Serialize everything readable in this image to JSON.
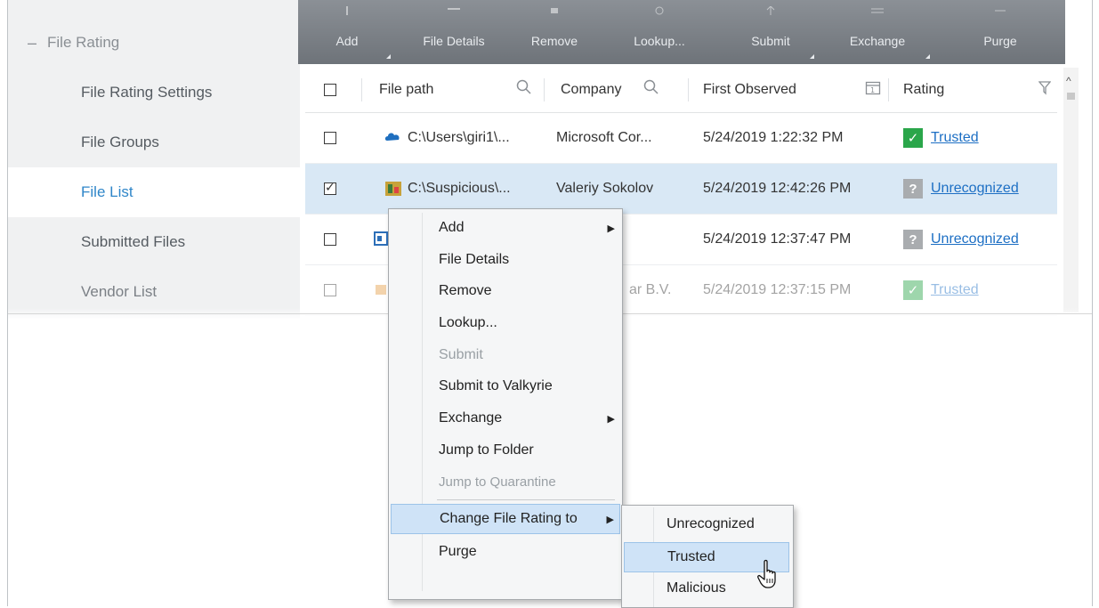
{
  "sidebar": {
    "section": "File Rating",
    "items": [
      {
        "label": "File Rating Settings"
      },
      {
        "label": "File Groups"
      },
      {
        "label": "File List"
      },
      {
        "label": "Submitted Files"
      },
      {
        "label": "Vendor List"
      }
    ]
  },
  "toolbar": {
    "buttons": [
      {
        "label": "Add"
      },
      {
        "label": "File Details"
      },
      {
        "label": "Remove"
      },
      {
        "label": "Lookup..."
      },
      {
        "label": "Submit"
      },
      {
        "label": "Exchange"
      },
      {
        "label": "Purge"
      }
    ]
  },
  "grid": {
    "columns": [
      "File path",
      "Company",
      "First Observed",
      "Rating"
    ],
    "rows": [
      {
        "path": "C:\\Users\\giri1\\...",
        "company": "Microsoft Cor...",
        "observed": "5/24/2019 1:22:32 PM",
        "rating": "Trusted",
        "checked": false,
        "icon": "cloud-icon"
      },
      {
        "path": "C:\\Suspicious\\...",
        "company": "Valeriy Sokolov",
        "observed": "5/24/2019 12:42:26 PM",
        "rating": "Unrecognized",
        "checked": true,
        "icon": "app-icon"
      },
      {
        "path": "",
        "company": "",
        "observed": "5/24/2019 12:37:47 PM",
        "rating": "Unrecognized",
        "checked": false,
        "icon": "window-icon"
      },
      {
        "path": "",
        "company": "ar B.V.",
        "observed": "5/24/2019 12:37:15 PM",
        "rating": "Trusted",
        "checked": false,
        "icon": "package-icon"
      }
    ]
  },
  "context_menu": {
    "items": [
      {
        "label": "Add"
      },
      {
        "label": "File Details"
      },
      {
        "label": "Remove"
      },
      {
        "label": "Lookup..."
      },
      {
        "label": "Submit"
      },
      {
        "label": "Submit to Valkyrie"
      },
      {
        "label": "Exchange"
      },
      {
        "label": "Jump to Folder"
      },
      {
        "label": "Jump to Quarantine"
      },
      {
        "label": "Change File Rating to"
      },
      {
        "label": "Purge"
      }
    ]
  },
  "submenu": {
    "items": [
      {
        "label": "Unrecognized"
      },
      {
        "label": "Trusted"
      },
      {
        "label": "Malicious"
      }
    ]
  },
  "colors": {
    "accent": "#2f86c9",
    "trusted": "#2aa64a",
    "unrecognized": "#a9acaf",
    "link": "#1d6fc4",
    "selected_row": "#d9e8f5",
    "menu_highlight": "#cfe3f7"
  }
}
